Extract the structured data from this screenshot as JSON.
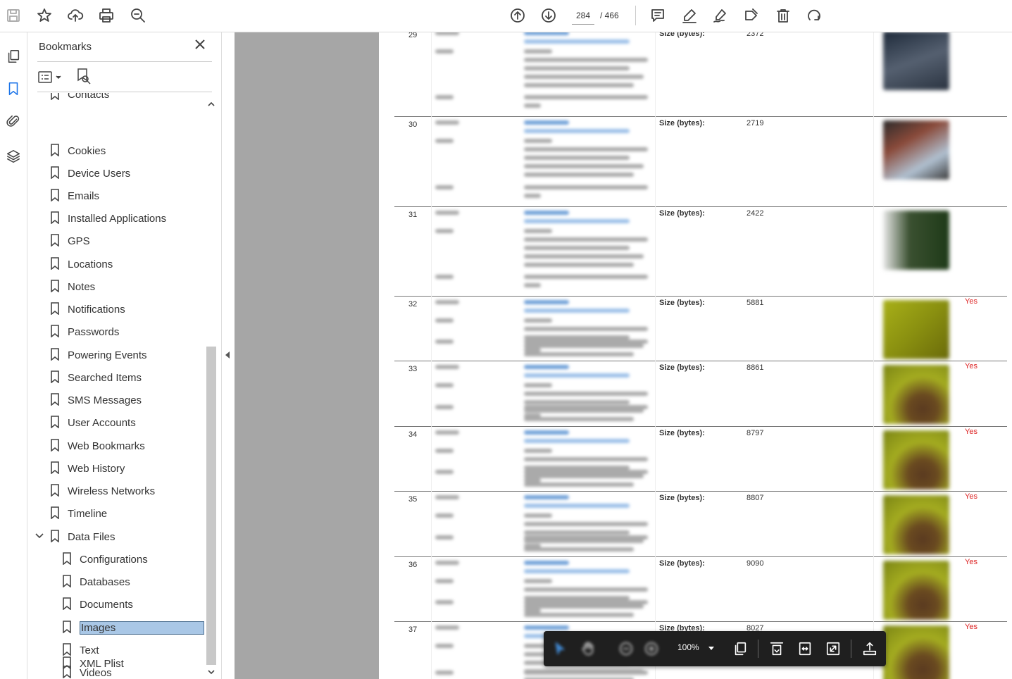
{
  "toolbar": {
    "page_current": "284",
    "page_total": "/ 466"
  },
  "panel": {
    "title": "Bookmarks",
    "bookmarks": [
      {
        "label": "Contacts"
      },
      {
        "label": "Cookies"
      },
      {
        "label": "Device Users"
      },
      {
        "label": "Emails"
      },
      {
        "label": "Installed Applications"
      },
      {
        "label": "GPS"
      },
      {
        "label": "Locations"
      },
      {
        "label": "Notes"
      },
      {
        "label": "Notifications"
      },
      {
        "label": "Passwords"
      },
      {
        "label": "Powering Events"
      },
      {
        "label": "Searched Items"
      },
      {
        "label": "SMS Messages"
      },
      {
        "label": "User Accounts"
      },
      {
        "label": "Web Bookmarks"
      },
      {
        "label": "Web History"
      },
      {
        "label": "Wireless Networks"
      },
      {
        "label": "Timeline"
      },
      {
        "label": "Data Files"
      }
    ],
    "children": [
      {
        "label": "Configurations"
      },
      {
        "label": "Databases"
      },
      {
        "label": "Documents"
      },
      {
        "label": "Images",
        "selected": true
      },
      {
        "label": "Text"
      },
      {
        "label": "Videos"
      },
      {
        "label": "XML Plist"
      }
    ]
  },
  "document": {
    "size_label": "Size (bytes):",
    "rows": [
      {
        "num": "29",
        "size": "2372",
        "yes": ""
      },
      {
        "num": "30",
        "size": "2719",
        "yes": ""
      },
      {
        "num": "31",
        "size": "2422",
        "yes": ""
      },
      {
        "num": "32",
        "size": "5881",
        "yes": "Yes"
      },
      {
        "num": "33",
        "size": "8861",
        "yes": "Yes"
      },
      {
        "num": "34",
        "size": "8797",
        "yes": "Yes"
      },
      {
        "num": "35",
        "size": "8807",
        "yes": "Yes"
      },
      {
        "num": "36",
        "size": "9090",
        "yes": "Yes"
      },
      {
        "num": "37",
        "size": "8027",
        "yes": "Yes"
      }
    ]
  },
  "floatbar": {
    "zoom": "100%"
  },
  "colors": {
    "selection": "#a9c7e6",
    "accent": "#1a73e8",
    "yes_red": "#dd2222",
    "doc_gray": "#a6a6a6",
    "floatbar": "#1f1f1f"
  }
}
